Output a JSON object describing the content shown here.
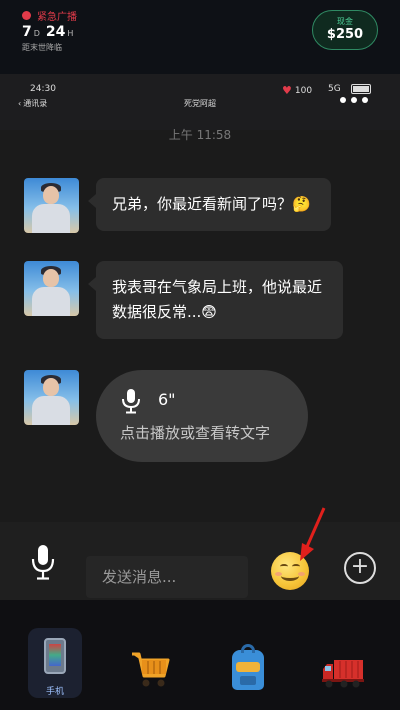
{
  "hud": {
    "alert_text": "紧急广播",
    "days": "7",
    "days_unit": "D",
    "hours": "24",
    "hours_unit": "H",
    "subtitle": "距末世降临",
    "cash_label": "现金",
    "cash_amount": "$250"
  },
  "status": {
    "time": "24:30",
    "back_label": "通讯录",
    "contact_name": "死党阿超",
    "health": "100",
    "network": "5G"
  },
  "chat": {
    "timestamp": "上午 11:58",
    "messages": [
      {
        "text": "兄弟，你最近看新闻了吗？🤔"
      },
      {
        "text": "我表哥在气象局上班，他说最近数据很反常...😨"
      }
    ],
    "voice": {
      "duration": "6\"",
      "hint": "点击播放或查看转文字"
    }
  },
  "input": {
    "placeholder": "发送消息...",
    "plus": "+"
  },
  "nav": {
    "phone_label": "手机"
  }
}
